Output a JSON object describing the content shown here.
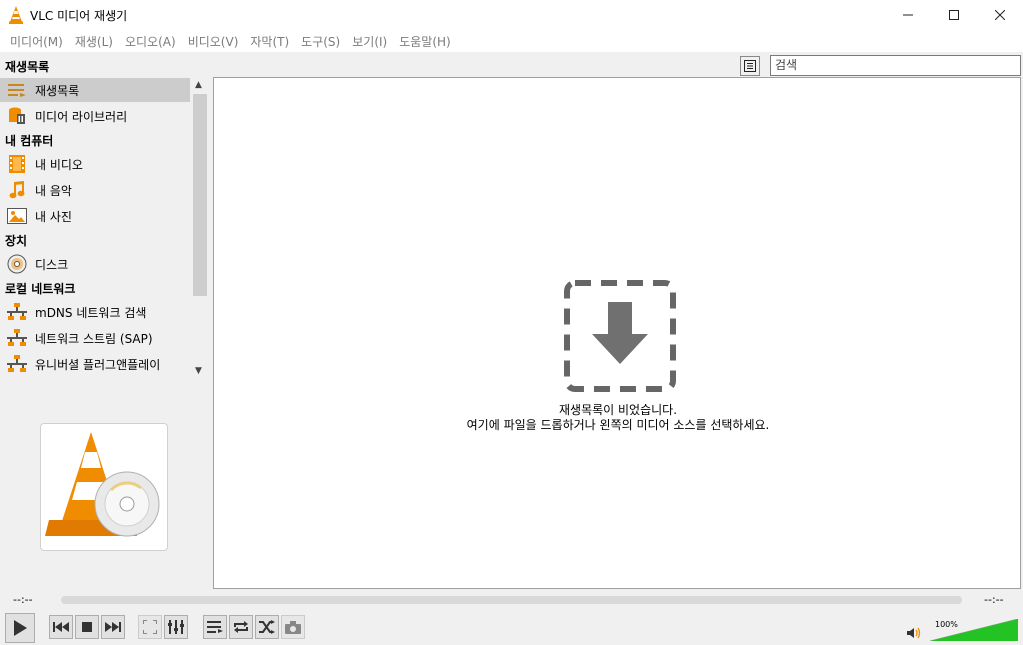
{
  "window": {
    "title": "VLC 미디어 재생기",
    "minimize_icon": "minimize-icon",
    "maximize_icon": "maximize-icon",
    "close_icon": "close-icon"
  },
  "menu": [
    "미디어(M)",
    "재생(L)",
    "오디오(A)",
    "비디오(V)",
    "자막(T)",
    "도구(S)",
    "보기(I)",
    "도움말(H)"
  ],
  "sidebar": {
    "sections": [
      {
        "header": "재생목록",
        "items": [
          {
            "label": "재생목록",
            "icon": "playlist-icon",
            "selected": true
          },
          {
            "label": "미디어 라이브러리",
            "icon": "media-library-icon"
          }
        ]
      },
      {
        "header": "내 컴퓨터",
        "items": [
          {
            "label": "내 비디오",
            "icon": "film-icon"
          },
          {
            "label": "내 음악",
            "icon": "music-note-icon"
          },
          {
            "label": "내 사진",
            "icon": "picture-icon"
          }
        ]
      },
      {
        "header": "장치",
        "items": [
          {
            "label": "디스크",
            "icon": "disc-icon"
          }
        ]
      },
      {
        "header": "로컬 네트워크",
        "items": [
          {
            "label": "mDNS 네트워크 검색",
            "icon": "network-icon"
          },
          {
            "label": "네트워크 스트림 (SAP)",
            "icon": "network-icon"
          },
          {
            "label": "유니버셜 플러그앤플레이",
            "icon": "network-icon"
          }
        ]
      }
    ]
  },
  "playlist": {
    "search_placeholder": "검색",
    "empty_line1": "재생목록이 비었습니다.",
    "empty_line2": "여기에 파일을 드롭하거나 왼쪽의 미디어 소스를 선택하세요."
  },
  "player": {
    "elapsed": "--:--",
    "remaining": "--:--",
    "volume_label": "100%",
    "volume_level": 1.0
  },
  "colors": {
    "accent_orange": "#f08c00",
    "volume_green": "#22c322"
  }
}
